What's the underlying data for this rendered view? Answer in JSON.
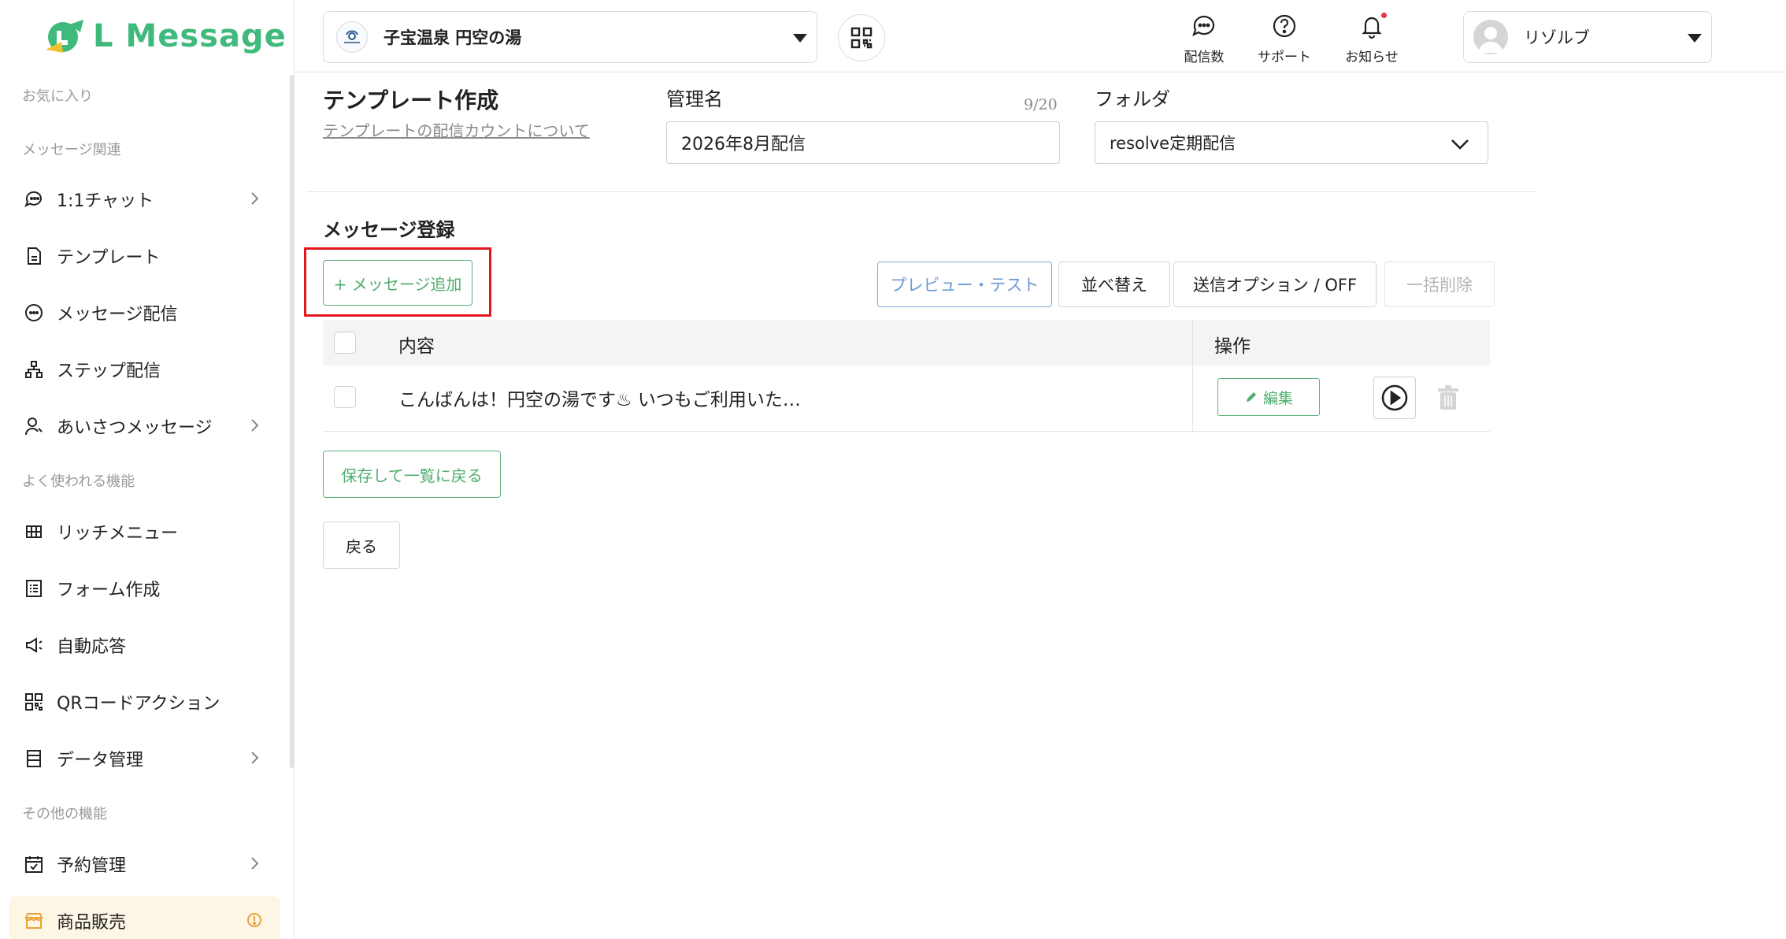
{
  "app": {
    "name": "L Message",
    "brand_color": "#3fb97c"
  },
  "sidebar": {
    "sections": {
      "favorites": "お気に入り",
      "message": "メッセージ関連",
      "frequent": "よく使われる機能",
      "other": "その他の機能"
    },
    "items": [
      {
        "label": "1:1チャット",
        "icon": "chat-bubble-icon",
        "chevron": true
      },
      {
        "label": "テンプレート",
        "icon": "document-icon",
        "chevron": false
      },
      {
        "label": "メッセージ配信",
        "icon": "message-dots-icon",
        "chevron": false
      },
      {
        "label": "ステップ配信",
        "icon": "step-tree-icon",
        "chevron": false
      },
      {
        "label": "あいさつメッセージ",
        "icon": "user-wave-icon",
        "chevron": true
      },
      {
        "label": "リッチメニュー",
        "icon": "grid-menu-icon",
        "chevron": false
      },
      {
        "label": "フォーム作成",
        "icon": "form-list-icon",
        "chevron": false
      },
      {
        "label": "自動応答",
        "icon": "megaphone-icon",
        "chevron": false
      },
      {
        "label": "QRコードアクション",
        "icon": "qr-code-icon",
        "chevron": false
      },
      {
        "label": "データ管理",
        "icon": "database-icon",
        "chevron": true
      },
      {
        "label": "予約管理",
        "icon": "calendar-check-icon",
        "chevron": true
      },
      {
        "label": "商品販売",
        "icon": "shop-icon",
        "active": true,
        "warning": true
      }
    ]
  },
  "header": {
    "account_name": "子宝温泉 円空の湯",
    "icons": [
      {
        "label": "配信数",
        "icon": "message-count-icon"
      },
      {
        "label": "サポート",
        "icon": "help-circle-icon"
      },
      {
        "label": "お知らせ",
        "icon": "bell-icon"
      }
    ],
    "user_name": "リゾルブ"
  },
  "main": {
    "title": "テンプレート作成",
    "count_link": "テンプレートの配信カウントについて",
    "name_label": "管理名",
    "name_counter": "9/20",
    "name_value": "2026年8月配信",
    "folder_label": "フォルダ",
    "folder_value": "resolve定期配信",
    "section_title": "メッセージ登録",
    "add_message": "+ メッセージ追加",
    "toolbar": {
      "preview": "プレビュー・テスト",
      "sort": "並べ替え",
      "send_option": "送信オプション / OFF",
      "bulk_delete": "一括削除"
    },
    "table": {
      "col_content": "内容",
      "col_actions": "操作",
      "rows": [
        {
          "content": "こんばんは！円空の湯です♨ いつもご利用いた…",
          "edit": "編集"
        }
      ]
    },
    "save_back": "保存して一覧に戻る",
    "back": "戻る"
  }
}
